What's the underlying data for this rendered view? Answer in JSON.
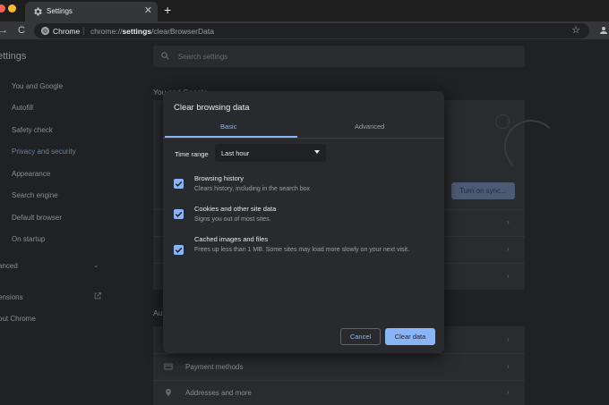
{
  "window": {
    "tab_title": "Settings",
    "tab_close": "✕",
    "new_tab": "+"
  },
  "toolbar": {
    "back": "→",
    "reload": "C",
    "omnibox_origin": "Chrome",
    "omnibox_sep": "|",
    "omnibox_url_prefix": "chrome://",
    "omnibox_url_bold": "settings",
    "omnibox_url_suffix": "/clearBrowserData",
    "star": "☆"
  },
  "settings": {
    "title": "ettings",
    "search_placeholder": "Search settings",
    "sidebar": [
      {
        "label": "You and Google"
      },
      {
        "label": "Autofill"
      },
      {
        "label": "Safety check"
      },
      {
        "label": "Privacy and security",
        "active": true
      },
      {
        "label": "Appearance"
      },
      {
        "label": "Search engine"
      },
      {
        "label": "Default browser"
      },
      {
        "label": "On startup"
      }
    ],
    "sidebar_advanced": "anced",
    "sidebar_extensions": "ensions",
    "sidebar_about": "out Chrome",
    "section_you": "You and Google",
    "section_autofill": "Aut",
    "sync_button": "Turn on sync...",
    "autofill_rows": [
      {
        "label": "Payment methods",
        "icon": "credit-card-icon"
      },
      {
        "label": "Addresses and more",
        "icon": "location-pin-icon"
      }
    ]
  },
  "dialog": {
    "title": "Clear browsing data",
    "tabs": [
      {
        "label": "Basic",
        "selected": true
      },
      {
        "label": "Advanced",
        "selected": false
      }
    ],
    "time_range_label": "Time range",
    "time_range_value": "Last hour",
    "options": [
      {
        "title": "Browsing history",
        "desc": "Clears history, including in the search box",
        "checked": true
      },
      {
        "title": "Cookies and other site data",
        "desc": "Signs you out of most sites.",
        "checked": true
      },
      {
        "title": "Cached images and files",
        "desc": "Frees up less than 1 MB. Some sites may load more slowly on your next visit.",
        "checked": true
      }
    ],
    "cancel_label": "Cancel",
    "clear_label": "Clear data"
  },
  "colors": {
    "accent": "#8ab4f8",
    "dialog_bg": "#292a2d",
    "page_bg": "#202124"
  }
}
